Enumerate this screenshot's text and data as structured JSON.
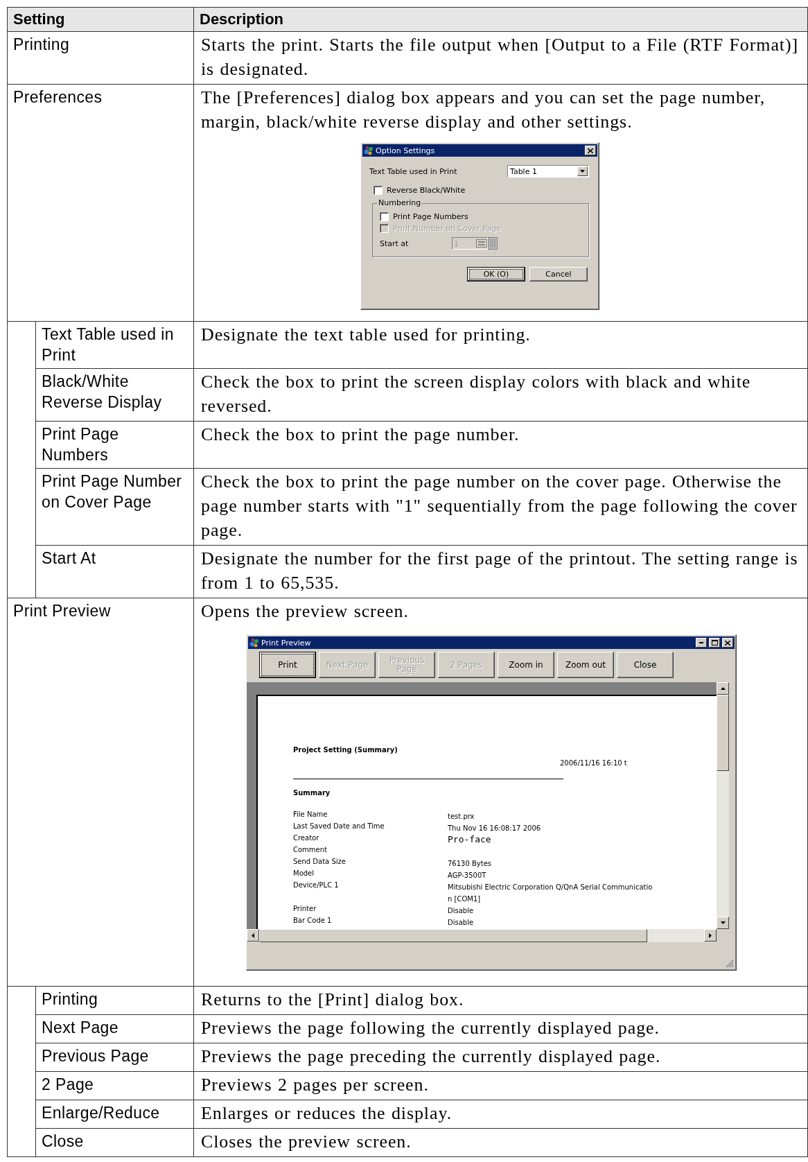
{
  "table": {
    "columns": [
      "Setting",
      "Description"
    ],
    "rows": [
      {
        "setting": "Printing",
        "description": "Starts the print. Starts the file output when [Output to a File (RTF Format)] is designated."
      },
      {
        "setting": "Preferences",
        "description": "The [Preferences] dialog box appears and you can set the page number, margin, black/white reverse display and other settings.",
        "screenshot": {
          "kind": "option_settings",
          "title": "Option Settings",
          "combo": {
            "label": "Text Table used in Print",
            "value": "Table 1"
          },
          "reverse": {
            "label": "Reverse Black/White",
            "checked": false
          },
          "group": {
            "title": "Numbering",
            "checkboxes": [
              {
                "label": "Print Page Numbers",
                "checked": false,
                "disabled": false
              },
              {
                "label": "Print Number on Cover Page",
                "checked": false,
                "disabled": true
              }
            ],
            "start_at": {
              "label": "Start at",
              "value": "1",
              "disabled": true
            }
          },
          "buttons": [
            {
              "label": "OK (O)",
              "focused": true
            },
            {
              "label": "Cancel",
              "focused": false
            }
          ]
        },
        "children": [
          {
            "setting": "Text Table used in Print",
            "description": "Designate the text table used for printing."
          },
          {
            "setting": "Black/White Reverse Display",
            "description": "Check the box to print the screen display colors with black and white reversed."
          },
          {
            "setting": "Print Page Numbers",
            "description": "Check the box to print the page number."
          },
          {
            "setting": "Print Page Number on Cover Page",
            "description": "Check the box to print the page number on the cover page. Otherwise the page number starts with \"1\" sequentially from the page following the cover page."
          },
          {
            "setting": "Start At",
            "description": "Designate the number for the first page of the printout. The setting range is from 1 to 65,535."
          }
        ]
      },
      {
        "setting": "Print Preview",
        "description": "Opens the preview screen.",
        "screenshot": {
          "kind": "print_preview",
          "title": "Print Preview",
          "buttons": [
            {
              "label": "Print",
              "disabled": false,
              "focused": true
            },
            {
              "label": "Next Page",
              "disabled": true,
              "focused": false
            },
            {
              "label": "Previous Page",
              "disabled": true,
              "focused": false
            },
            {
              "label": "2 Pages",
              "disabled": true,
              "focused": false
            },
            {
              "label": "Zoom in",
              "disabled": false,
              "focused": false
            },
            {
              "label": "Zoom out",
              "disabled": false,
              "focused": false
            },
            {
              "label": "Close",
              "disabled": false,
              "focused": false
            }
          ],
          "page": {
            "title": "Project Setting (Summary)",
            "date": "2006/11/16 16:10 t",
            "section": "Summary",
            "fields": [
              {
                "label": "File Name",
                "kind": "text",
                "lines": [
                  "test.prx"
                ]
              },
              {
                "label": "Last Saved Date and Time",
                "kind": "text",
                "lines": [
                  "Thu Nov 16 16:08:17 2006"
                ]
              },
              {
                "label": "Creator",
                "kind": "mono",
                "lines": [
                  "Pro-face"
                ]
              },
              {
                "label": "Comment",
                "kind": "text"
              },
              {
                "label": "Send Data Size",
                "kind": "text",
                "lines": [
                  "76130  Bytes"
                ]
              },
              {
                "label": "Model",
                "kind": "text",
                "lines": [
                  "AGP-3500T"
                ]
              },
              {
                "label": "Device/PLC 1",
                "kind": "text",
                "lines": [
                  "Mitsubishi Electric Corporation Q/QnA Serial Communicatio",
                  "n [COM1]"
                ]
              },
              {
                "label": "Printer",
                "kind": "text",
                "lines": [
                  "Disable"
                ]
              },
              {
                "label": "Bar Code 1",
                "kind": "text",
                "lines": [
                  "Disable"
                ]
              }
            ]
          }
        },
        "children": [
          {
            "setting": "Printing",
            "description": "Returns to the [Print] dialog box."
          },
          {
            "setting": "Next Page",
            "description": "Previews the page following the currently displayed page."
          },
          {
            "setting": "Previous Page",
            "description": "Previews the page preceding the currently displayed page."
          },
          {
            "setting": "2 Page",
            "description": "Previews 2 pages per screen."
          },
          {
            "setting": "Enlarge/Reduce",
            "description": "Enlarges or reduces the display."
          },
          {
            "setting": "Close",
            "description": "Closes the preview screen."
          }
        ]
      }
    ]
  }
}
